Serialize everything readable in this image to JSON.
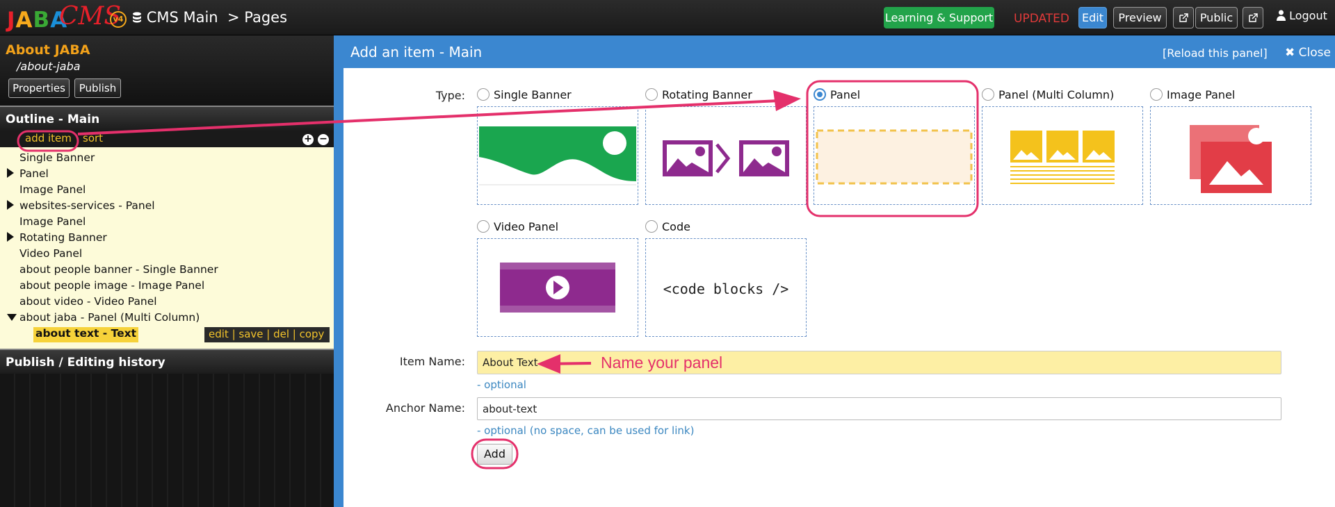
{
  "topbar": {
    "logo": {
      "j": "J",
      "a": "A",
      "b": "B",
      "a2": "A",
      "cms": "CMS",
      "version": "v4"
    },
    "breadcrumb_root": "CMS Main",
    "breadcrumb_sep": ">",
    "breadcrumb_page": "Pages",
    "learning": "Learning & Support",
    "status": "UPDATED",
    "edit": "Edit",
    "preview": "Preview",
    "public": "Public",
    "logout": "Logout"
  },
  "sidebar": {
    "page_title": "About JABA",
    "page_slug": "/about-jaba",
    "properties": "Properties",
    "publish": "Publish",
    "outline_header": "Outline - Main",
    "add_item": "add item",
    "sort": "sort",
    "items": [
      {
        "label": "Single Banner"
      },
      {
        "label": "Panel"
      },
      {
        "label": "Image Panel"
      },
      {
        "label": "websites-services - Panel"
      },
      {
        "label": "Image Panel"
      },
      {
        "label": "Rotating Banner"
      },
      {
        "label": "Video Panel"
      },
      {
        "label": "about people banner - Single Banner"
      },
      {
        "label": "about people image - Image Panel"
      },
      {
        "label": "about video - Video Panel"
      },
      {
        "label": "about jaba - Panel (Multi Column)"
      }
    ],
    "selected_item": "about text - Text",
    "actions": "edit | save | del | copy",
    "history_header": "Publish / Editing history"
  },
  "panel": {
    "title": "Add an item - Main",
    "reload": "[Reload this panel]",
    "close": "Close",
    "type_label": "Type:",
    "types": [
      {
        "label": "Single Banner"
      },
      {
        "label": "Rotating Banner"
      },
      {
        "label": "Panel"
      },
      {
        "label": "Panel (Multi Column)"
      },
      {
        "label": "Image Panel"
      },
      {
        "label": "Video Panel"
      },
      {
        "label": "Code"
      }
    ],
    "selected_type": "Panel",
    "code_tile_text": "<code blocks />",
    "item_name_label": "Item Name:",
    "item_name_value": "About Text",
    "item_name_hint": "- optional",
    "anchor_label": "Anchor Name:",
    "anchor_value": "about-text",
    "anchor_hint": "- optional (no space, can be used for link)",
    "add_button": "Add",
    "annotation": "Name your panel"
  },
  "colors": {
    "accent_blue": "#3b87d0",
    "annotation_pink": "#e4306b",
    "learning_green": "#22a34a",
    "outline_bg": "#fdfbd9",
    "sidebar_title": "#f3a21a"
  }
}
